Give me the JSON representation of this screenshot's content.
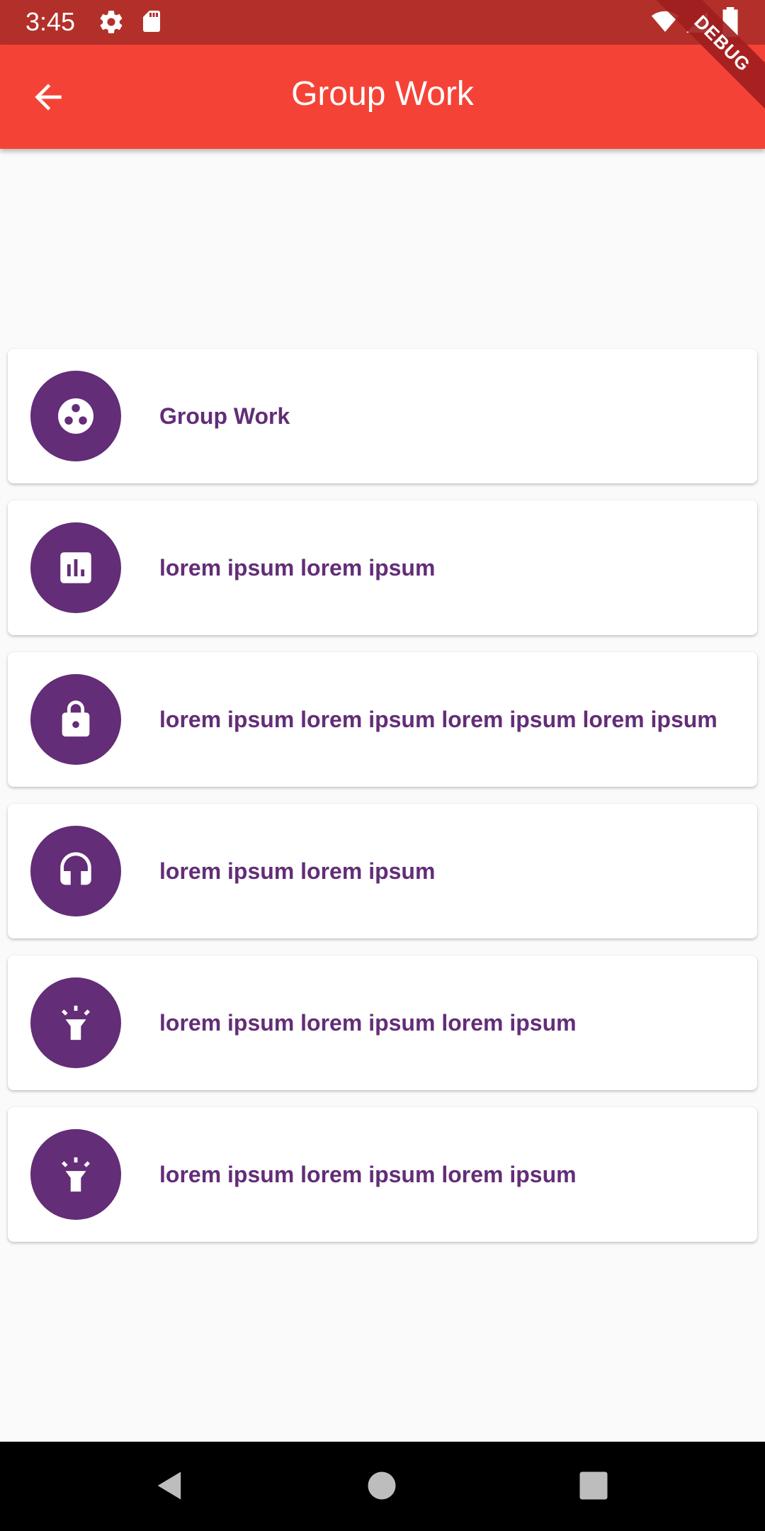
{
  "status_bar": {
    "time": "3:45",
    "icons": [
      "settings-icon",
      "sd-card-icon",
      "wifi-icon",
      "signal-icon",
      "battery-icon"
    ]
  },
  "app_bar": {
    "title": "Group Work",
    "back_icon": "arrow-back-icon",
    "debug_banner": "DEBUG"
  },
  "list": {
    "items": [
      {
        "label": "Group Work",
        "icon": "group-work-icon"
      },
      {
        "label": "lorem ipsum lorem ipsum",
        "icon": "bar-chart-icon"
      },
      {
        "label": "lorem ipsum lorem ipsum lorem ipsum lorem ipsum",
        "icon": "lock-icon"
      },
      {
        "label": "lorem ipsum lorem ipsum",
        "icon": "headset-icon"
      },
      {
        "label": "lorem ipsum lorem ipsum lorem ipsum",
        "icon": "flashlight-icon"
      },
      {
        "label": "lorem ipsum lorem ipsum lorem ipsum",
        "icon": "flashlight-icon"
      }
    ]
  },
  "nav_bar": {
    "buttons": [
      "back-triangle-icon",
      "home-circle-icon",
      "recents-square-icon"
    ]
  },
  "colors": {
    "status_bar": "#b3302a",
    "app_bar": "#f44336",
    "accent_purple": "#632d77",
    "background": "#fafafa"
  }
}
